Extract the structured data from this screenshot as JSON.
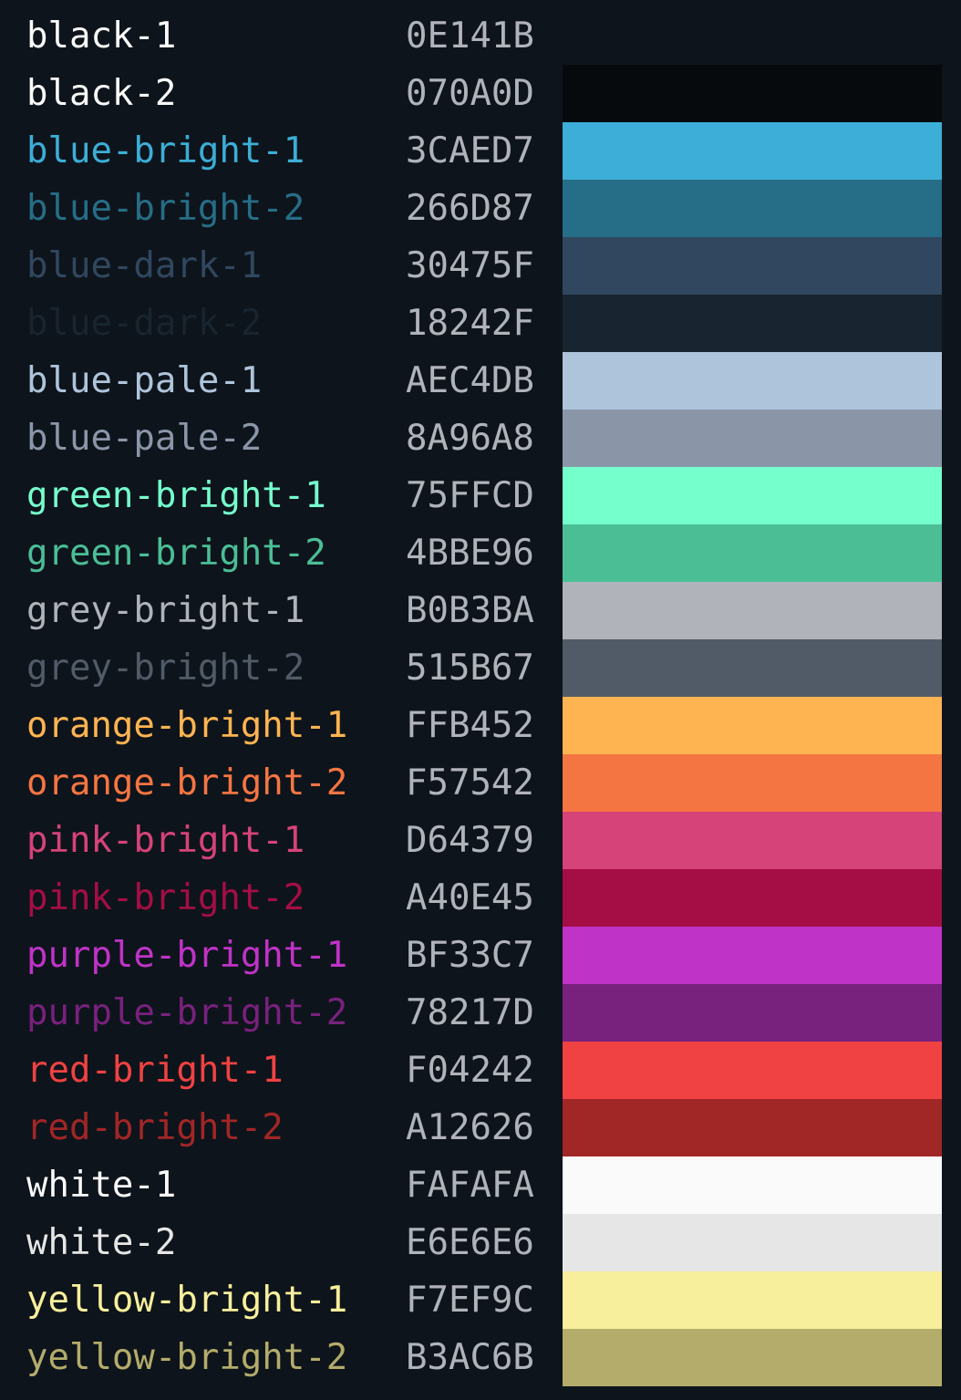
{
  "colors": [
    {
      "name": "black-1",
      "hex": "0E141B",
      "color": "#0E141B"
    },
    {
      "name": "black-2",
      "hex": "070A0D",
      "color": "#070A0D"
    },
    {
      "name": "blue-bright-1",
      "hex": "3CAED7",
      "color": "#3CAED7"
    },
    {
      "name": "blue-bright-2",
      "hex": "266D87",
      "color": "#266D87"
    },
    {
      "name": "blue-dark-1",
      "hex": "30475F",
      "color": "#30475F"
    },
    {
      "name": "blue-dark-2",
      "hex": "18242F",
      "color": "#18242F"
    },
    {
      "name": "blue-pale-1",
      "hex": "AEC4DB",
      "color": "#AEC4DB"
    },
    {
      "name": "blue-pale-2",
      "hex": "8A96A8",
      "color": "#8A96A8"
    },
    {
      "name": "green-bright-1",
      "hex": "75FFCD",
      "color": "#75FFCD"
    },
    {
      "name": "green-bright-2",
      "hex": "4BBE96",
      "color": "#4BBE96"
    },
    {
      "name": "grey-bright-1",
      "hex": "B0B3BA",
      "color": "#B0B3BA"
    },
    {
      "name": "grey-bright-2",
      "hex": "515B67",
      "color": "#515B67"
    },
    {
      "name": "orange-bright-1",
      "hex": "FFB452",
      "color": "#FFB452"
    },
    {
      "name": "orange-bright-2",
      "hex": "F57542",
      "color": "#F57542"
    },
    {
      "name": "pink-bright-1",
      "hex": "D64379",
      "color": "#D64379"
    },
    {
      "name": "pink-bright-2",
      "hex": "A40E45",
      "color": "#A40E45"
    },
    {
      "name": "purple-bright-1",
      "hex": "BF33C7",
      "color": "#BF33C7"
    },
    {
      "name": "purple-bright-2",
      "hex": "78217D",
      "color": "#78217D"
    },
    {
      "name": "red-bright-1",
      "hex": "F04242",
      "color": "#F04242"
    },
    {
      "name": "red-bright-2",
      "hex": "A12626",
      "color": "#A12626"
    },
    {
      "name": "white-1",
      "hex": "FAFAFA",
      "color": "#FAFAFA"
    },
    {
      "name": "white-2",
      "hex": "E6E6E6",
      "color": "#E6E6E6"
    },
    {
      "name": "yellow-bright-1",
      "hex": "F7EF9C",
      "color": "#F7EF9C"
    },
    {
      "name": "yellow-bright-2",
      "hex": "B3AC6B",
      "color": "#B3AC6B"
    }
  ],
  "theme": {
    "background": "#0E141B",
    "hex_text": "#B0B3BA"
  }
}
